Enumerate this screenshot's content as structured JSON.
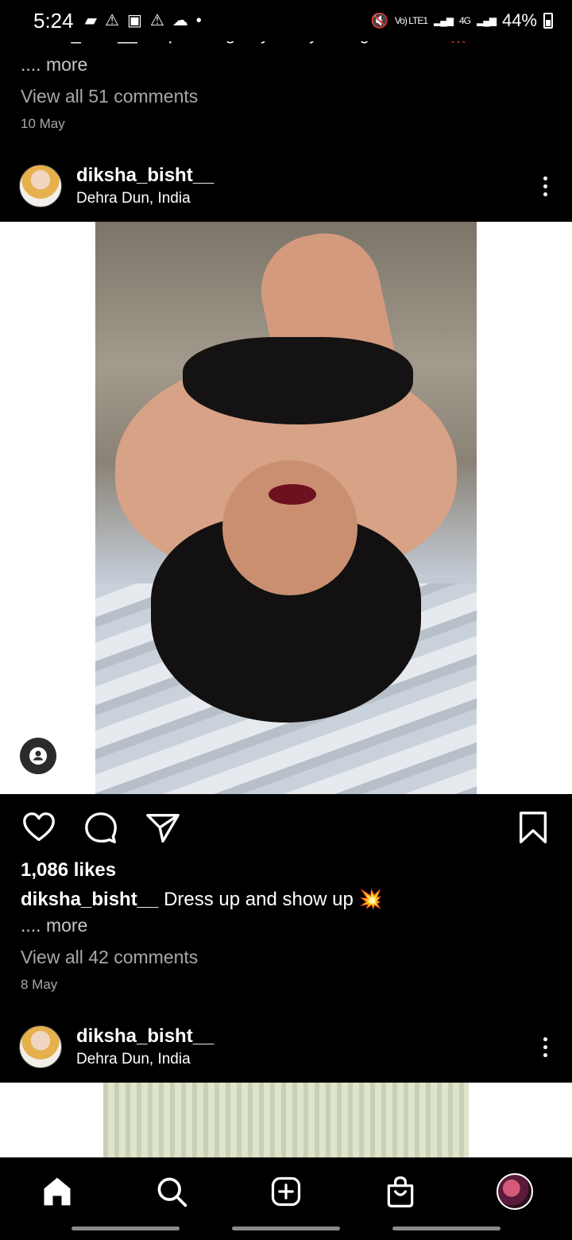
{
  "status_bar": {
    "time": "5:24",
    "network": "Vo) LTE1",
    "network2": "4G",
    "battery": "44%"
  },
  "previous_post": {
    "caption_clipped": "diksha_bisht__ Stop staring or your eyes might fall out 💥",
    "more": ".... more",
    "comments": "View all 51 comments",
    "date": "10 May"
  },
  "post": {
    "username": "diksha_bisht__",
    "location": "Dehra Dun, India",
    "likes": "1,086 likes",
    "caption_user": "diksha_bisht__",
    "caption_text": " Dress up and show up ",
    "caption_emoji": "💥",
    "more": ".... more",
    "comments": "View all 42 comments",
    "date": "8 May"
  },
  "next_post": {
    "username": "diksha_bisht__",
    "location": "Dehra Dun, India"
  },
  "icons": {
    "like": "heart-icon",
    "comment": "comment-icon",
    "share": "send-icon",
    "save": "bookmark-icon",
    "tag": "user-tag-icon",
    "home": "home-icon",
    "search": "search-icon",
    "create": "add-post-icon",
    "shop": "shop-bag-icon",
    "profile": "profile-avatar"
  }
}
